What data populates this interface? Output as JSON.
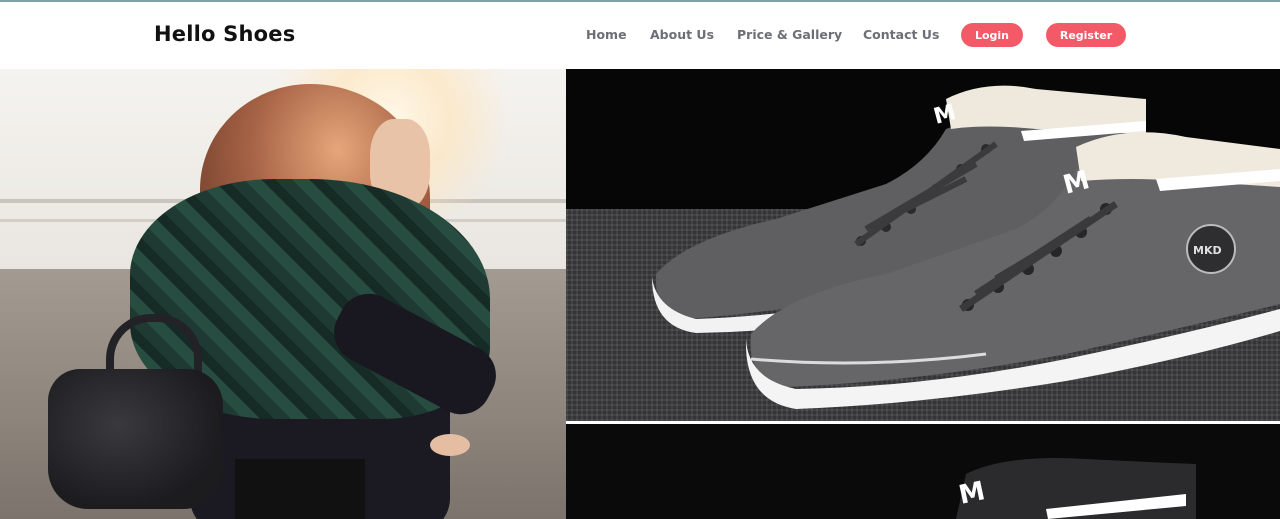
{
  "header": {
    "brand": "Hello Shoes",
    "nav": {
      "home": "Home",
      "about": "About Us",
      "gallery": "Price & Gallery",
      "contact": "Contact Us"
    },
    "buttons": {
      "login": "Login",
      "register": "Register"
    }
  },
  "colors": {
    "accent": "#f25a67",
    "nav_text": "#6b6f76",
    "brand_text": "#111111"
  }
}
